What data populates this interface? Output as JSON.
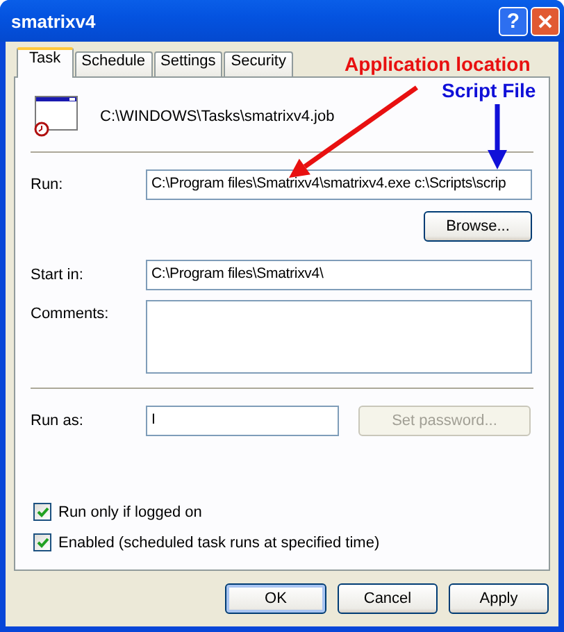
{
  "window": {
    "title": "smatrixv4",
    "help": "?"
  },
  "tabs": [
    {
      "label": "Task",
      "selected": true
    },
    {
      "label": "Schedule",
      "selected": false
    },
    {
      "label": "Settings",
      "selected": false
    },
    {
      "label": "Security",
      "selected": false
    }
  ],
  "job_path": "C:\\WINDOWS\\Tasks\\smatrixv4.job",
  "run": {
    "label": "Run:",
    "value": "C:\\Program files\\Smatrixv4\\smatrixv4.exe  c:\\Scripts\\scrip"
  },
  "browse": {
    "label": "Browse...",
    "disabled": false
  },
  "start_in": {
    "label": "Start in:",
    "value": "C:\\Program files\\Smatrixv4\\"
  },
  "comments": {
    "label": "Comments:"
  },
  "run_as": {
    "label": "Run as:",
    "value": "I"
  },
  "set_password": {
    "label": "Set password...",
    "disabled": true
  },
  "checkboxes": [
    {
      "label": "Run only if logged on",
      "checked": true
    },
    {
      "label": "Enabled (scheduled task runs at specified time)",
      "checked": true
    }
  ],
  "buttons": [
    {
      "label": "OK",
      "default": true
    },
    {
      "label": "Cancel",
      "default": false
    },
    {
      "label": "Apply",
      "default": false
    }
  ],
  "annotations": [
    {
      "text": "Application location",
      "color": "#e81010"
    },
    {
      "text": "Script File",
      "color": "#1010d8"
    }
  ]
}
